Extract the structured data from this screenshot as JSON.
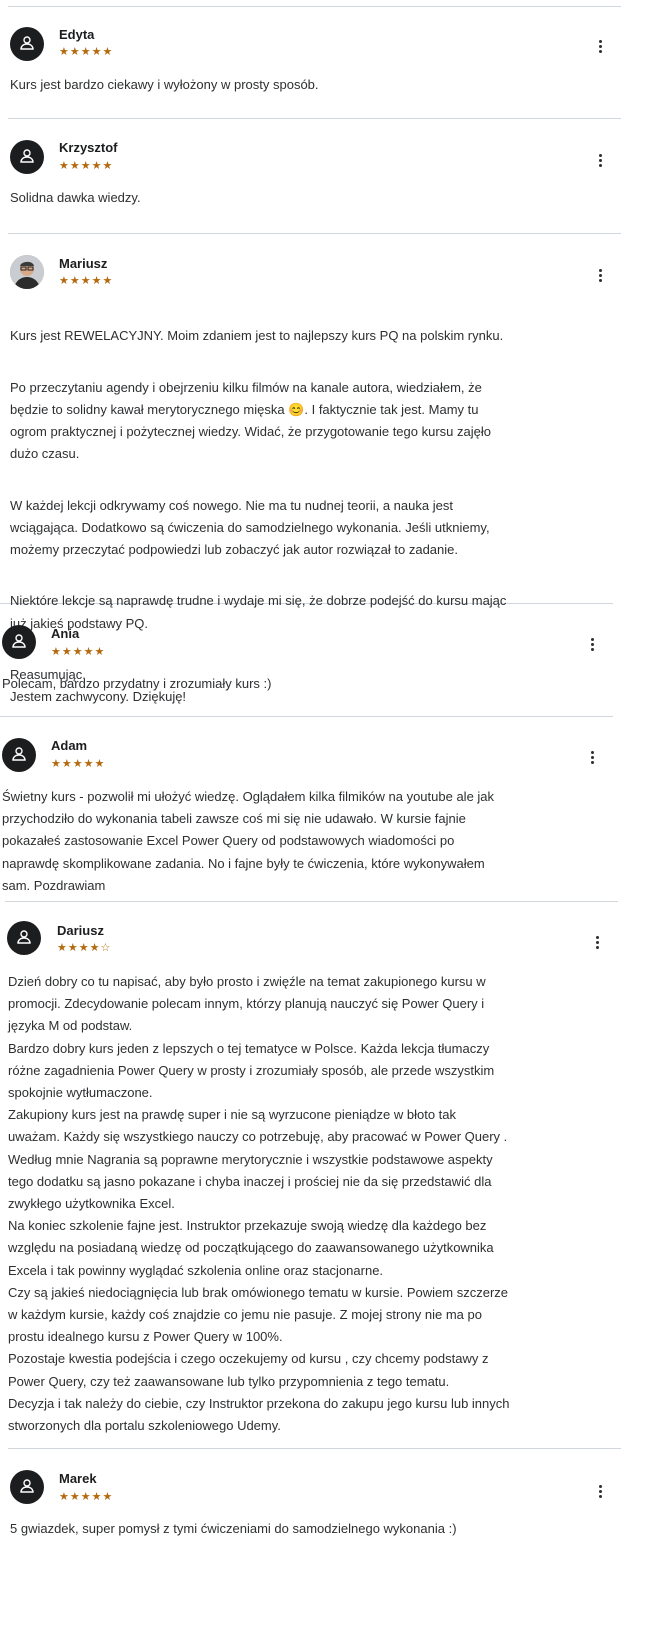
{
  "reviews": [
    {
      "name": "Edyta",
      "rating": 5,
      "text": [
        "Kurs jest bardzo ciekawy i wyłożony w prosty sposób."
      ]
    },
    {
      "name": "Krzysztof",
      "rating": 5,
      "text": [
        "Solidna dawka wiedzy."
      ]
    },
    {
      "name": "Mariusz",
      "rating": 5,
      "text": [
        "Kurs jest REWELACYJNY. Moim zdaniem jest to najlepszy kurs PQ na polskim rynku.",
        "Po przeczytaniu agendy i obejrzeniu kilku filmów na kanale autora, wiedziałem, że\nbędzie to solidny kawał merytorycznego mięska 😊. I faktycznie tak jest. Mamy tu\nogrom praktycznej i pożytecznej wiedzy. Widać, że przygotowanie tego kursu zajęło\ndużo czasu.",
        "W każdej lekcji odkrywamy coś nowego. Nie ma tu nudnej teorii, a nauka jest\nwciągająca. Dodatkowo są ćwiczenia do samodzielnego wykonania. Jeśli utkniemy,\nmożemy przeczytać podpowiedzi lub zobaczyć jak autor rozwiązał to zadanie.",
        "Niektóre lekcje są naprawdę trudne i wydaje mi się, że dobrze podejść do kursu mając\njuż jakieś podstawy PQ.",
        "Reasumując.\nJestem zachwycony. Dziękuję!"
      ]
    },
    {
      "name": "Ania",
      "rating": 5,
      "text": [
        "Polecam, bardzo przydatny i zrozumiały kurs :)"
      ]
    },
    {
      "name": "Adam",
      "rating": 5,
      "text": [
        "Świetny kurs - pozwolił mi ułożyć wiedzę. Oglądałem kilka filmików na youtube ale jak\nprzychodziło do wykonania tabeli zawsze coś mi się nie udawało. W kursie fajnie\npokazałeś zastosowanie Excel Power Query od podstawowych wiadomości po\nnaprawdę skomplikowane zadania. No i fajne były te ćwiczenia, które wykonywałem\nsam. Pozdrawiam"
      ]
    },
    {
      "name": "Dariusz",
      "rating": 4,
      "text": [
        "Dzień dobry co tu napisać, aby było prosto i zwięźle na temat zakupionego kursu w\npromocji. Zdecydowanie polecam innym, którzy planują nauczyć się Power Query i\njęzyka M od podstaw.\nBardzo dobry kurs jeden z lepszych o tej tematyce w Polsce. Każda lekcja tłumaczy\nróżne zagadnienia Power Query w prosty i zrozumiały sposób, ale przede wszystkim\nspokojnie wytłumaczone.\nZakupiony kurs jest na prawdę super i nie są wyrzucone pieniądze w błoto tak\nuważam. Każdy się wszystkiego nauczy co potrzebuję, aby pracować w Power Query .\nWedług mnie Nagrania są poprawne merytorycznie i wszystkie podstawowe aspekty\ntego dodatku są jasno pokazane i chyba inaczej i prościej nie da się przedstawić dla\nzwykłego użytkownika Excel.\nNa koniec szkolenie fajne jest. Instruktor przekazuje swoją wiedzę dla każdego bez\nwzględu na posiadaną wiedzę od początkującego do zaawansowanego użytkownika\nExcela i tak powinny wyglądać szkolenia online oraz stacjonarne.\nCzy są jakieś niedociągnięcia lub brak omówionego tematu w kursie. Powiem szczerze\nw każdym kursie, każdy coś znajdzie co jemu nie pasuje. Z mojej strony nie ma po\nprostu idealnego kursu z Power Query w 100%.\nPozostaje kwestia podejścia i czego oczekujemy od kursu , czy chcemy podstawy z\nPower Query, czy też zaawansowane lub tylko przypomnienia z tego tematu.\nDecyzja i tak należy do ciebie, czy Instruktor przekona do zakupu jego kursu lub innych\nstworzonych dla portalu szkoleniowego Udemy."
      ]
    },
    {
      "name": "Marek",
      "rating": 5,
      "text": [
        "5 gwiazdek, super pomysł z tymi ćwiczeniami do samodzielnego wykonania :)"
      ]
    }
  ],
  "colors": {
    "star": "#b4690e",
    "avatar": "#1c1d1f",
    "divider": "#d1d7dc"
  },
  "icons": {
    "avatar": "user-icon",
    "menu": "more-vertical-icon",
    "star": "star-icon"
  }
}
